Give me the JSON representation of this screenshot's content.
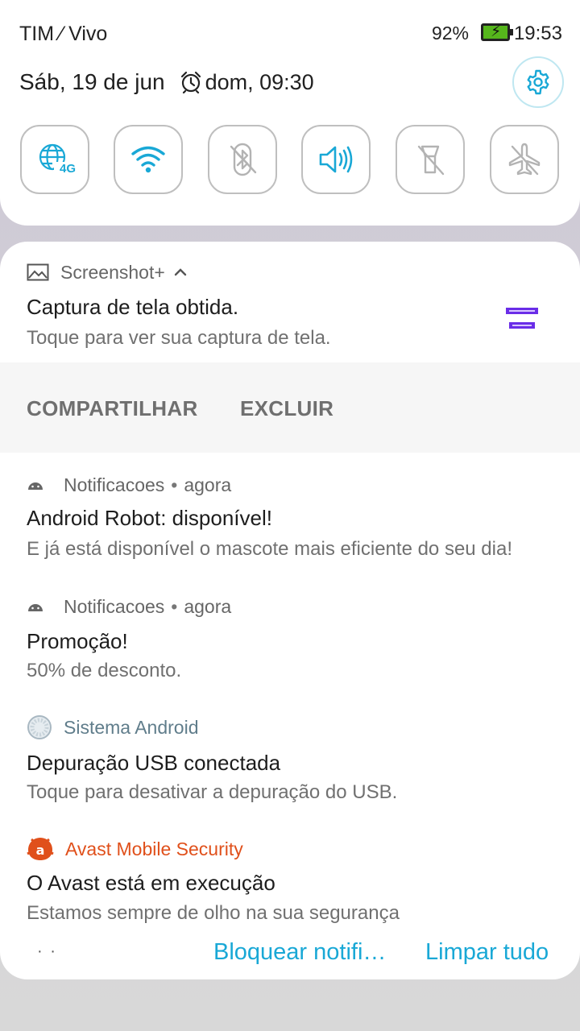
{
  "status_bar": {
    "carrier": "TIM ⁄ Vivo",
    "battery_percent": "92%",
    "battery_level": 0.92,
    "battery_charging": true,
    "time": "19:53"
  },
  "quick_settings": {
    "date": "Sáb, 19 de jun",
    "alarm": "dom, 09:30",
    "settings_icon": "gear-icon",
    "accent_color": "#19a8d6",
    "tiles": [
      {
        "name": "mobile-data-4g",
        "icon": "globe-4g-icon",
        "badge": "4G",
        "active": true
      },
      {
        "name": "wifi",
        "icon": "wifi-icon",
        "active": true
      },
      {
        "name": "bluetooth",
        "icon": "bluetooth-off-icon",
        "active": false
      },
      {
        "name": "sound",
        "icon": "volume-icon",
        "active": true
      },
      {
        "name": "flashlight",
        "icon": "flashlight-off-icon",
        "active": false
      },
      {
        "name": "airplane-mode",
        "icon": "airplane-off-icon",
        "active": false
      }
    ]
  },
  "notifications": {
    "screenshot": {
      "app": "Screenshot+",
      "title": "Captura de tela obtida.",
      "text": "Toque para ver sua captura de tela.",
      "actions": [
        "COMPARTILHAR",
        "EXCLUIR"
      ]
    },
    "robot": {
      "app": "Notificacoes",
      "time": "agora",
      "title": "Android Robot: disponível!",
      "text": "E já está disponível o mascote mais eficiente do seu dia!"
    },
    "promo": {
      "app": "Notificacoes",
      "time": "agora",
      "title": "Promoção!",
      "text": "50% de desconto."
    },
    "usb": {
      "app": "Sistema Android",
      "title": "Depuração USB conectada",
      "text": "Toque para desativar a depuração do USB."
    },
    "avast": {
      "app": "Avast Mobile Security",
      "app_color": "#e0501b",
      "title": "O Avast está em execução",
      "text": "Estamos sempre de olho na sua segurança"
    },
    "separator": "•"
  },
  "footer": {
    "more": "· ·",
    "block": "Bloquear notifi…",
    "clear": "Limpar tudo"
  }
}
